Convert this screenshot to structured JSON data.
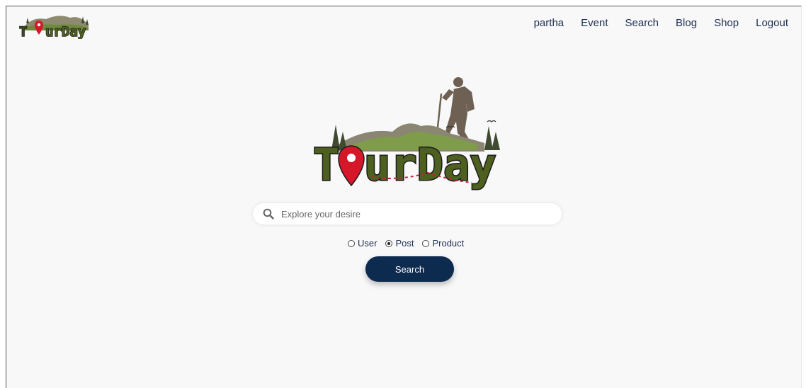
{
  "nav": {
    "brand": "TourDay",
    "links": [
      {
        "label": "partha"
      },
      {
        "label": "Event"
      },
      {
        "label": "Search"
      },
      {
        "label": "Blog"
      },
      {
        "label": "Shop"
      },
      {
        "label": "Logout"
      }
    ]
  },
  "hero": {
    "brand": "TourDay"
  },
  "search": {
    "placeholder": "Explore your desire",
    "value": "",
    "options": [
      {
        "label": "User",
        "checked": false
      },
      {
        "label": "Post",
        "checked": true
      },
      {
        "label": "Product",
        "checked": false
      }
    ],
    "button_label": "Search"
  },
  "colors": {
    "accent": "#0d2a4f",
    "nav_text": "#1c2f52",
    "logo_green": "#4a5e1f",
    "logo_red": "#d6172a",
    "logo_brown": "#6e6052"
  }
}
